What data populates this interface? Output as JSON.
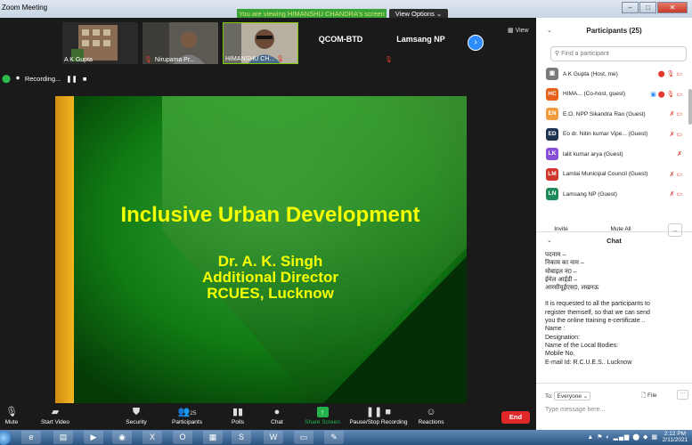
{
  "window": {
    "title": "Zoom Meeting"
  },
  "banner": {
    "text": "You are viewing HIMANSHU CHANDRA's screen",
    "view_options": "View Options ⌄"
  },
  "thumbnails": [
    {
      "name": "A K Gupta"
    },
    {
      "name": "Nirupama Pr..."
    },
    {
      "name": "HIMANSHU CH..."
    },
    {
      "name": "QCOM-BTD"
    },
    {
      "name": "Lamsang NP"
    }
  ],
  "view_label": "View",
  "recording": {
    "text": "Recording..."
  },
  "slide": {
    "title": "Inclusive Urban Development",
    "lines": [
      "Dr. A. K. Singh",
      "Additional Director",
      "RCUES, Lucknow"
    ]
  },
  "toolbar": {
    "mute": "Mute",
    "start_video": "Start Video",
    "security": "Security",
    "participants": "Participants",
    "participants_count": "25",
    "polls": "Polls",
    "chat": "Chat",
    "share_screen": "Share Screen",
    "pause_recording": "Pause/Stop Recording",
    "reactions": "Reactions",
    "end": "End"
  },
  "participants_panel": {
    "title": "Participants (25)",
    "search_placeholder": "Find a participant",
    "participants": [
      {
        "initials": "",
        "name": "A K Gupta (Host, me)",
        "color": "#7a7a7a"
      },
      {
        "initials": "HC",
        "name": "HIMA...   (Co-host, guest)",
        "color": "#e8611a"
      },
      {
        "initials": "EN",
        "name": "E.O. NPP Sikandra Rao (Guest)",
        "color": "#f39a3a"
      },
      {
        "initials": "ED",
        "name": "Eo dr. Nitin kumar Vipe...  (Guest)",
        "color": "#1e3350"
      },
      {
        "initials": "LK",
        "name": "lalit kumar arya (Guest)",
        "color": "#8a4fd8"
      },
      {
        "initials": "LM",
        "name": "Lamlai Municipal Council (Guest)",
        "color": "#d0372c"
      },
      {
        "initials": "LN",
        "name": "Lamsang NP (Guest)",
        "color": "#1f8a5a"
      }
    ],
    "invite": "Invite",
    "mute_all": "Mute All",
    "more": "..."
  },
  "chat_panel": {
    "title": "Chat",
    "messages": [
      "पदनाम –",
      "निकाय का नाम –",
      "मोबाइल नं0 –",
      "ईमेल आईडी –",
      "आरसीयूईएस0, लखनऊ",
      "",
      "It is requested to all the participants to",
      "register themself, so that we can send",
      "you the online training e-certificate ..",
      "Name :",
      "Designation:",
      "Name of the Local Bodies:",
      "Mobile No.",
      "E-mail Id: R.C.U.E.S.. Lucknow"
    ],
    "to_label": "To:",
    "to_value": "Everyone ⌄",
    "file_label": "File",
    "more": "···",
    "type_placeholder": "Type message here..."
  },
  "taskbar": {
    "time": "2:12 PM",
    "date": "2/11/2021"
  }
}
